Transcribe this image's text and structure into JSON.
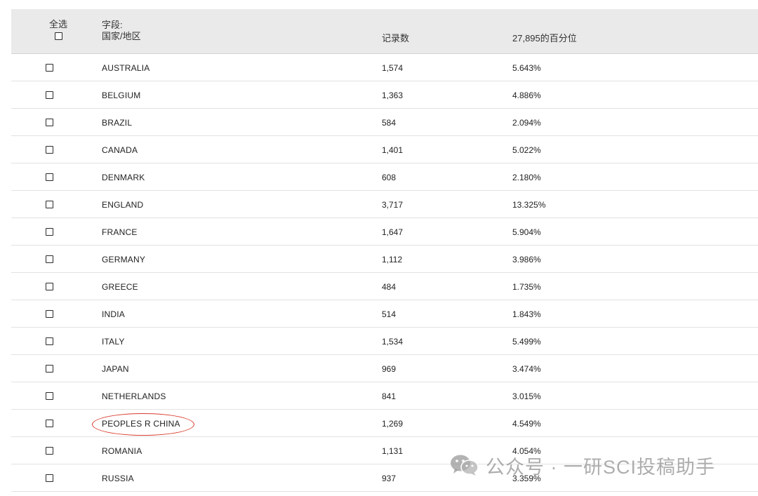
{
  "header": {
    "select_all_label": "全选",
    "field_label": "字段:",
    "field_name": "国家/地区",
    "records_label": "记录数",
    "percent_label": "27,895的百分位"
  },
  "rows": [
    {
      "country": "AUSTRALIA",
      "records": "1,574",
      "percent": "5.643%"
    },
    {
      "country": "BELGIUM",
      "records": "1,363",
      "percent": "4.886%"
    },
    {
      "country": "BRAZIL",
      "records": "584",
      "percent": "2.094%"
    },
    {
      "country": "CANADA",
      "records": "1,401",
      "percent": "5.022%"
    },
    {
      "country": "DENMARK",
      "records": "608",
      "percent": "2.180%"
    },
    {
      "country": "ENGLAND",
      "records": "3,717",
      "percent": "13.325%"
    },
    {
      "country": "FRANCE",
      "records": "1,647",
      "percent": "5.904%"
    },
    {
      "country": "GERMANY",
      "records": "1,112",
      "percent": "3.986%"
    },
    {
      "country": "GREECE",
      "records": "484",
      "percent": "1.735%"
    },
    {
      "country": "INDIA",
      "records": "514",
      "percent": "1.843%"
    },
    {
      "country": "ITALY",
      "records": "1,534",
      "percent": "5.499%"
    },
    {
      "country": "JAPAN",
      "records": "969",
      "percent": "3.474%"
    },
    {
      "country": "NETHERLANDS",
      "records": "841",
      "percent": "3.015%"
    },
    {
      "country": "PEOPLES R CHINA",
      "records": "1,269",
      "percent": "4.549%"
    },
    {
      "country": "ROMANIA",
      "records": "1,131",
      "percent": "4.054%"
    },
    {
      "country": "RUSSIA",
      "records": "937",
      "percent": "3.359%"
    }
  ],
  "watermark": {
    "icon": "wechat-icon",
    "text": "公众号 · 一研SCI投稿助手"
  },
  "colors": {
    "header_bg": "#eaeaea",
    "row_divider": "#e2e2e2",
    "highlight": "#d93a2b"
  }
}
